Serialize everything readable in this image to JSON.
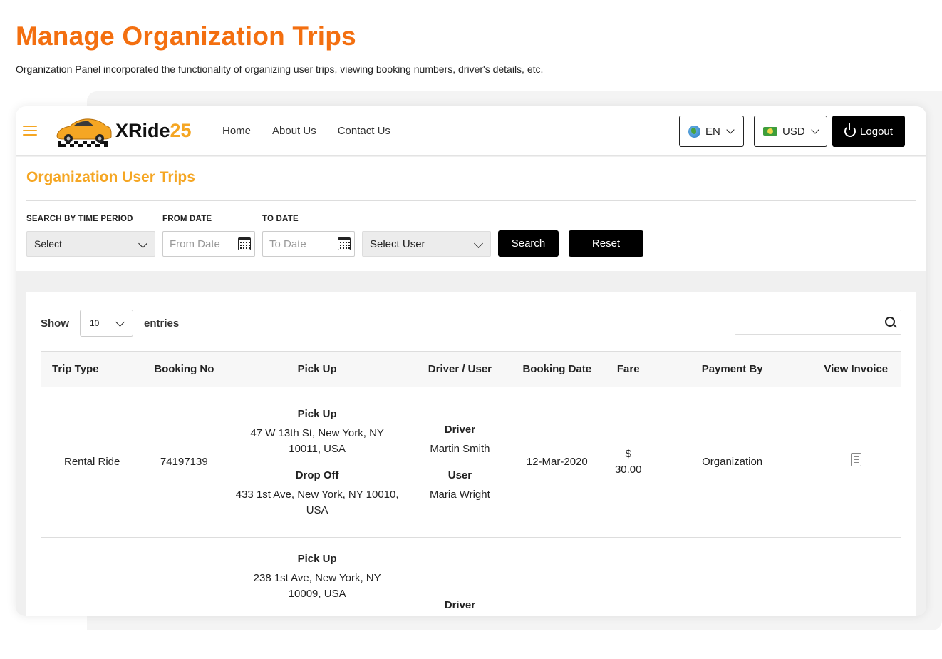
{
  "page": {
    "title": "Manage Organization Trips",
    "subtitle": "Organization Panel incorporated the functionality of organizing user trips, viewing booking numbers, driver's details, etc."
  },
  "navbar": {
    "brand": {
      "main": "XRide",
      "accent": "25"
    },
    "links": [
      "Home",
      "About Us",
      "Contact Us"
    ],
    "language": "EN",
    "currency": "USD",
    "logout_label": "Logout",
    "icons": {
      "menu": "hamburger-icon",
      "language": "globe-icon",
      "currency": "money-icon",
      "logout": "power-icon"
    }
  },
  "filters": {
    "section_title": "Organization User Trips",
    "time_period": {
      "label": "SEARCH BY TIME PERIOD",
      "value": "Select"
    },
    "from_date": {
      "label": "FROM DATE",
      "placeholder": "From Date"
    },
    "to_date": {
      "label": "TO DATE",
      "placeholder": "To Date"
    },
    "user": {
      "value": "Select User"
    },
    "search_label": "Search",
    "reset_label": "Reset"
  },
  "table": {
    "show_label": "Show",
    "entries_value": "10",
    "entries_label": "entries",
    "columns": [
      "Trip Type",
      "Booking No",
      "Pick Up",
      "Driver / User",
      "Booking Date",
      "Fare",
      "Payment By",
      "View Invoice"
    ],
    "rows": [
      {
        "trip_type": "Rental Ride",
        "booking_no": "74197139",
        "pickup_label": "Pick Up",
        "pickup_line1": "47 W 13th St, New York, NY",
        "pickup_line2": "10011, USA",
        "dropoff_label": "Drop Off",
        "dropoff_line1": "433 1st Ave, New York, NY 10010,",
        "dropoff_line2": "USA",
        "driver_label": "Driver",
        "driver": "Martin Smith",
        "user_label": "User",
        "user": "Maria Wright",
        "booking_date": "12-Mar-2020",
        "fare_currency": "$",
        "fare_amount": "30.00",
        "payment_by": "Organization",
        "invoice_icon": "invoice-icon"
      },
      {
        "pickup_label": "Pick Up",
        "pickup_line1": "238 1st Ave, New York, NY",
        "pickup_line2": "10009, USA",
        "driver_label": "Driver"
      }
    ]
  },
  "colors": {
    "title_orange": "#f36f10",
    "brand_accent": "#f5a623",
    "button_black": "#000000"
  }
}
